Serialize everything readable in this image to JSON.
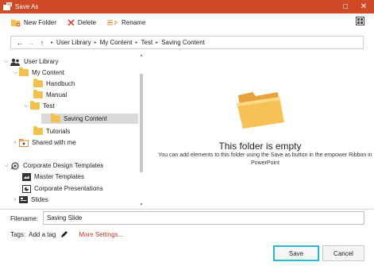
{
  "window": {
    "title": "Save As",
    "close_glyph": "✕",
    "maximize_glyph": "□"
  },
  "toolbar": {
    "new_folder": "New Folder",
    "delete": "Delete",
    "rename": "Rename"
  },
  "breadcrumb": [
    "User Library",
    "My Content",
    "Test",
    "Saving Content"
  ],
  "tree": [
    {
      "label": "User Library",
      "chevron": "⌵",
      "icon": "user-library-icon"
    },
    {
      "label": "My Content",
      "chevron": "⌵",
      "icon": "folder-icon"
    },
    {
      "label": "Handbuch",
      "chevron": "",
      "icon": "folder-icon"
    },
    {
      "label": "Manual",
      "chevron": "",
      "icon": "folder-icon"
    },
    {
      "label": "Test",
      "chevron": "⌵",
      "icon": "folder-icon"
    },
    {
      "label": "Saving Content",
      "chevron": "",
      "icon": "folder-icon",
      "selected": true
    },
    {
      "label": "Tutorials",
      "chevron": "",
      "icon": "folder-icon"
    },
    {
      "label": "Shared with me",
      "chevron": "›",
      "icon": "shared-folder-icon"
    },
    {
      "label": "Corporate Design Templates",
      "chevron": "⌵",
      "icon": "corporate-icon"
    },
    {
      "label": "Master Templates",
      "chevron": "",
      "icon": "master-templates-icon"
    },
    {
      "label": "Corporate Presentations",
      "chevron": "",
      "icon": "presentations-icon"
    },
    {
      "label": "Slides",
      "chevron": "›",
      "icon": "slides-icon"
    }
  ],
  "empty": {
    "title": "This folder is empty",
    "description": "You can add elements to this folder using the Save as button in the empower Ribbon in PowerPoint"
  },
  "filename": {
    "label": "Filename:",
    "value": "Saving Slide"
  },
  "tags": {
    "label": "Tags:",
    "add": "Add a tag",
    "more": "More Settings..."
  },
  "buttons": {
    "save": "Save",
    "cancel": "Cancel"
  },
  "colors": {
    "titlebar": "#d04a25",
    "accent": "#2cb5d8",
    "link": "#c0392b",
    "folder": "#f3c24e"
  }
}
